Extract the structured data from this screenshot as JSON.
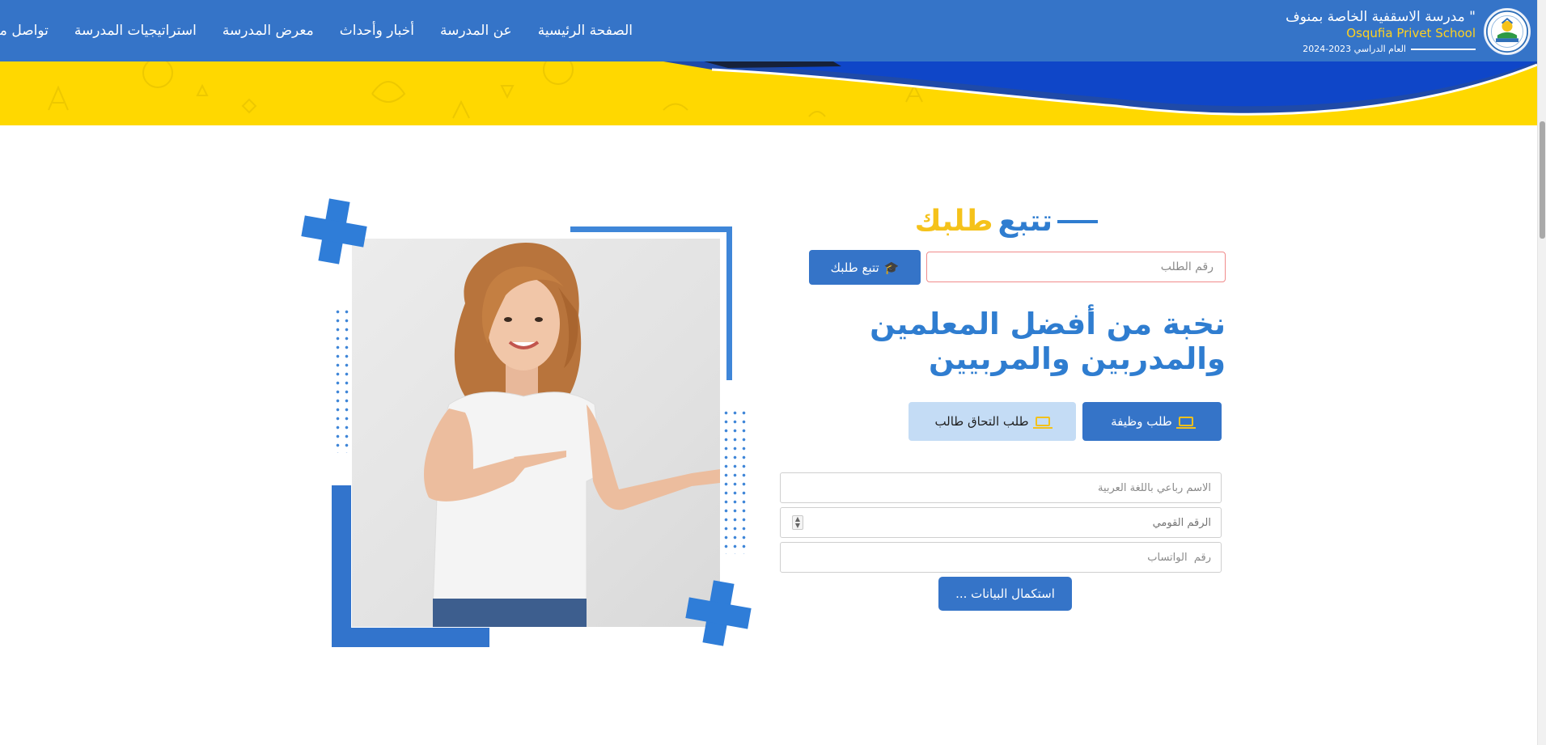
{
  "header": {
    "school_name_ar": "مدرسة الاسقفية الخاصة بمنوف \"",
    "school_name_en": "Osqufia Privet School",
    "academic_year": "العام الدراسي 2023-2024",
    "nav": [
      "الصفحة الرئيسية",
      "عن المدرسة",
      "أخبار وأحداث",
      "معرض المدرسة",
      "استراتيجيات المدرسة",
      "تواصل معنا"
    ]
  },
  "track": {
    "title_part1": "تتبع",
    "title_part2": "طلبك",
    "input_placeholder": "رقم الطلب",
    "button_label": "تتبع طلبك"
  },
  "headline": "نخبة من أفضل المعلمين والمدربين والمربيين",
  "tabs": {
    "job": "طلب وظيفة",
    "enroll": "طلب التحاق طالب"
  },
  "form": {
    "name_placeholder": "الاسم رباعي باللغة العربية",
    "national_id_placeholder": "الرقم القومي",
    "whatsapp_placeholder": "رقم  الواتساب",
    "submit_label": "استكمال البيانات ..."
  },
  "colors": {
    "primary": "#3574c8",
    "accent": "#ffd800",
    "title_blue": "#2f7dd0",
    "title_yellow": "#f5c21a"
  }
}
